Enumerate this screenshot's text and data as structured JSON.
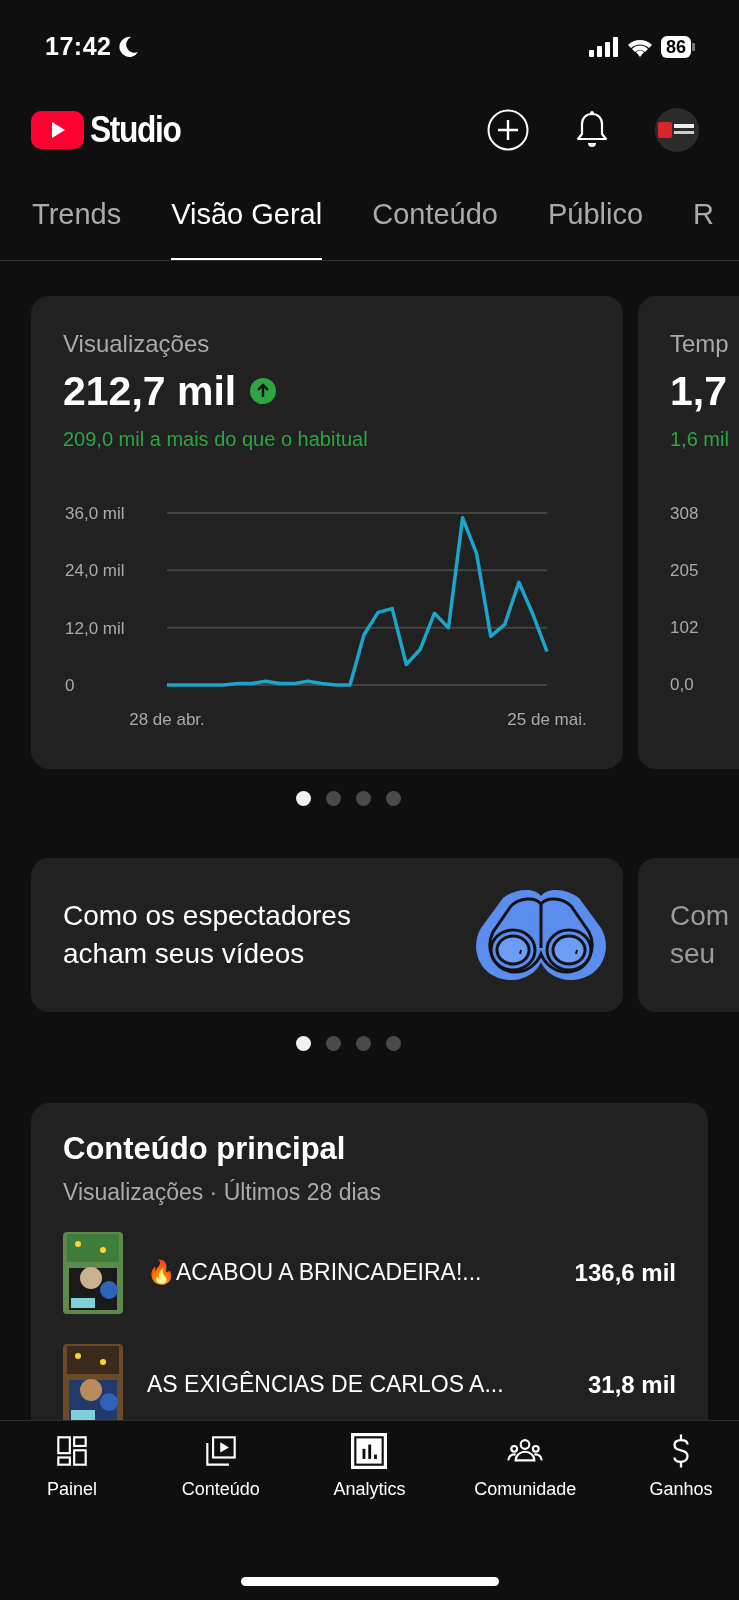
{
  "status_bar": {
    "time": "17:42",
    "battery": "86"
  },
  "header": {
    "logo_text": "Studio"
  },
  "tabs": [
    {
      "label": "Trends",
      "selected": false
    },
    {
      "label": "Visão Geral",
      "selected": true
    },
    {
      "label": "Conteúdo",
      "selected": false
    },
    {
      "label": "Público",
      "selected": false
    },
    {
      "label": "R",
      "selected": false
    }
  ],
  "metric_cards": [
    {
      "title": "Visualizações",
      "value": "212,7 mil",
      "rising": true,
      "delta": "209,0 mil a mais do que o habitual",
      "chart_data": {
        "type": "line",
        "categories": [
          "28 de abr.",
          null,
          null,
          null,
          null,
          null,
          null,
          null,
          null,
          null,
          null,
          null,
          null,
          null,
          null,
          null,
          null,
          null,
          null,
          null,
          null,
          null,
          null,
          null,
          null,
          null,
          null,
          "25 de mai."
        ],
        "ylim": [
          0,
          36
        ],
        "yticks": [
          {
            "value": 36,
            "label": "36,0 mil"
          },
          {
            "value": 24,
            "label": "24,0 mil"
          },
          {
            "value": 12,
            "label": "12,0 mil"
          },
          {
            "value": 0,
            "label": "0"
          }
        ],
        "series": [
          {
            "color": "#1ba4cc",
            "values": [
              0,
              0,
              0,
              0,
              0,
              0.3,
              0.3,
              0.8,
              0.3,
              0.3,
              0.8,
              0.3,
              0,
              0,
              10.5,
              15.2,
              16,
              4.3,
              7.5,
              15,
              12,
              35,
              27.5,
              10.2,
              12.7,
              21.5,
              14.8,
              7
            ]
          }
        ]
      }
    },
    {
      "title": "Temp",
      "value": "1,7",
      "delta": "1,6 mil",
      "axis_labels": [
        "308",
        "205",
        "102",
        "0,0"
      ]
    }
  ],
  "metric_dots": [
    {
      "selected": true
    },
    {
      "selected": false
    },
    {
      "selected": false
    },
    {
      "selected": false
    }
  ],
  "insight_cards": [
    {
      "text": "Como os espectadores acham seus vídeos",
      "selected": true
    },
    {
      "text": "Com seu",
      "selected": false
    }
  ],
  "insight_dots": [
    {
      "selected": true
    },
    {
      "selected": false
    },
    {
      "selected": false
    },
    {
      "selected": false
    }
  ],
  "top_content": {
    "title": "Conteúdo principal",
    "subtitle": "Visualizações · Últimos 28 dias",
    "items": [
      {
        "title": "🔥ACABOU A BRINCADEIRA!...",
        "views": "136,6 mil"
      },
      {
        "title": "AS EXIGÊNCIAS DE CARLOS A...",
        "views": "31,8 mil"
      }
    ]
  },
  "bottom_nav": [
    {
      "label": "Painel",
      "selected": false
    },
    {
      "label": "Conteúdo",
      "selected": false
    },
    {
      "label": "Analytics",
      "selected": true
    },
    {
      "label": "Comunidade",
      "selected": false
    },
    {
      "label": "Ganhos",
      "selected": false
    }
  ]
}
